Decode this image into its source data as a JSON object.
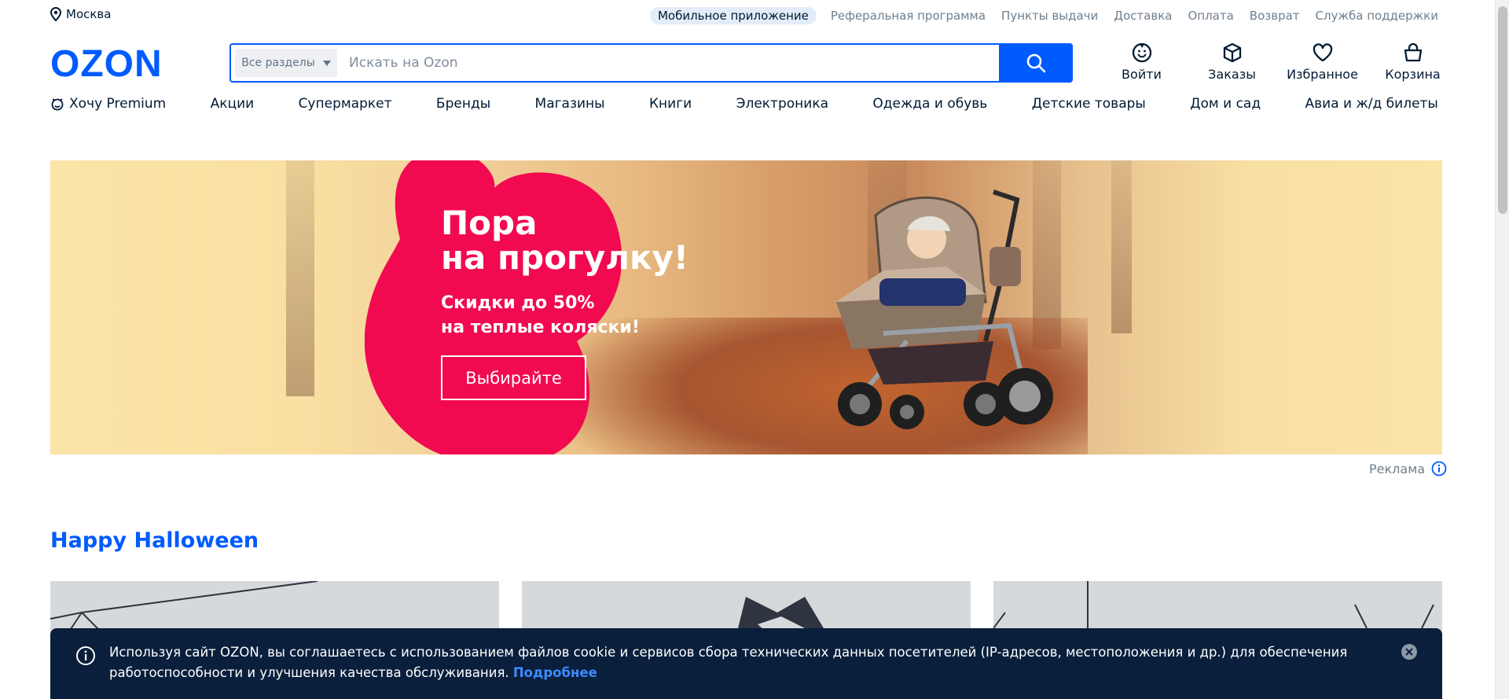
{
  "topbar": {
    "location": "Москва",
    "links": [
      "Мобильное приложение",
      "Реферальная программа",
      "Пункты выдачи",
      "Доставка",
      "Оплата",
      "Возврат",
      "Служба поддержки"
    ]
  },
  "header": {
    "logo": "OZON",
    "search": {
      "category": "Все разделы",
      "placeholder": "Искать на Ozon"
    },
    "actions": [
      {
        "label": "Войти",
        "icon": "smile-icon"
      },
      {
        "label": "Заказы",
        "icon": "box-icon"
      },
      {
        "label": "Избранное",
        "icon": "heart-icon"
      },
      {
        "label": "Корзина",
        "icon": "basket-icon"
      }
    ]
  },
  "catnav": [
    "Хочу Premium",
    "Акции",
    "Супермаркет",
    "Бренды",
    "Магазины",
    "Книги",
    "Электроника",
    "Одежда и обувь",
    "Детские товары",
    "Дом и сад",
    "Авиа и ж/д билеты"
  ],
  "banner": {
    "title_line1": "Пора",
    "title_line2": "на прогулку!",
    "sub_line1": "Скидки до 50%",
    "sub_line2": "на теплые коляски!",
    "button": "Выбирайте",
    "ad_label": "Реклама",
    "colors": {
      "blob": "#f20a50",
      "background": "#fbe4a8"
    }
  },
  "section": {
    "title": "Happy Halloween"
  },
  "cookie": {
    "text": "Используя сайт OZON, вы соглашаетесь с использованием файлов cookie и сервисов сбора технических данных посетителей (IP-адресов, местоположения и др.) для обеспечения работоспособности и улучшения качества обслуживания.",
    "more": "Подробнее"
  },
  "colors": {
    "brand": "#005bff",
    "text": "#001a34",
    "muted": "#707f8d"
  }
}
